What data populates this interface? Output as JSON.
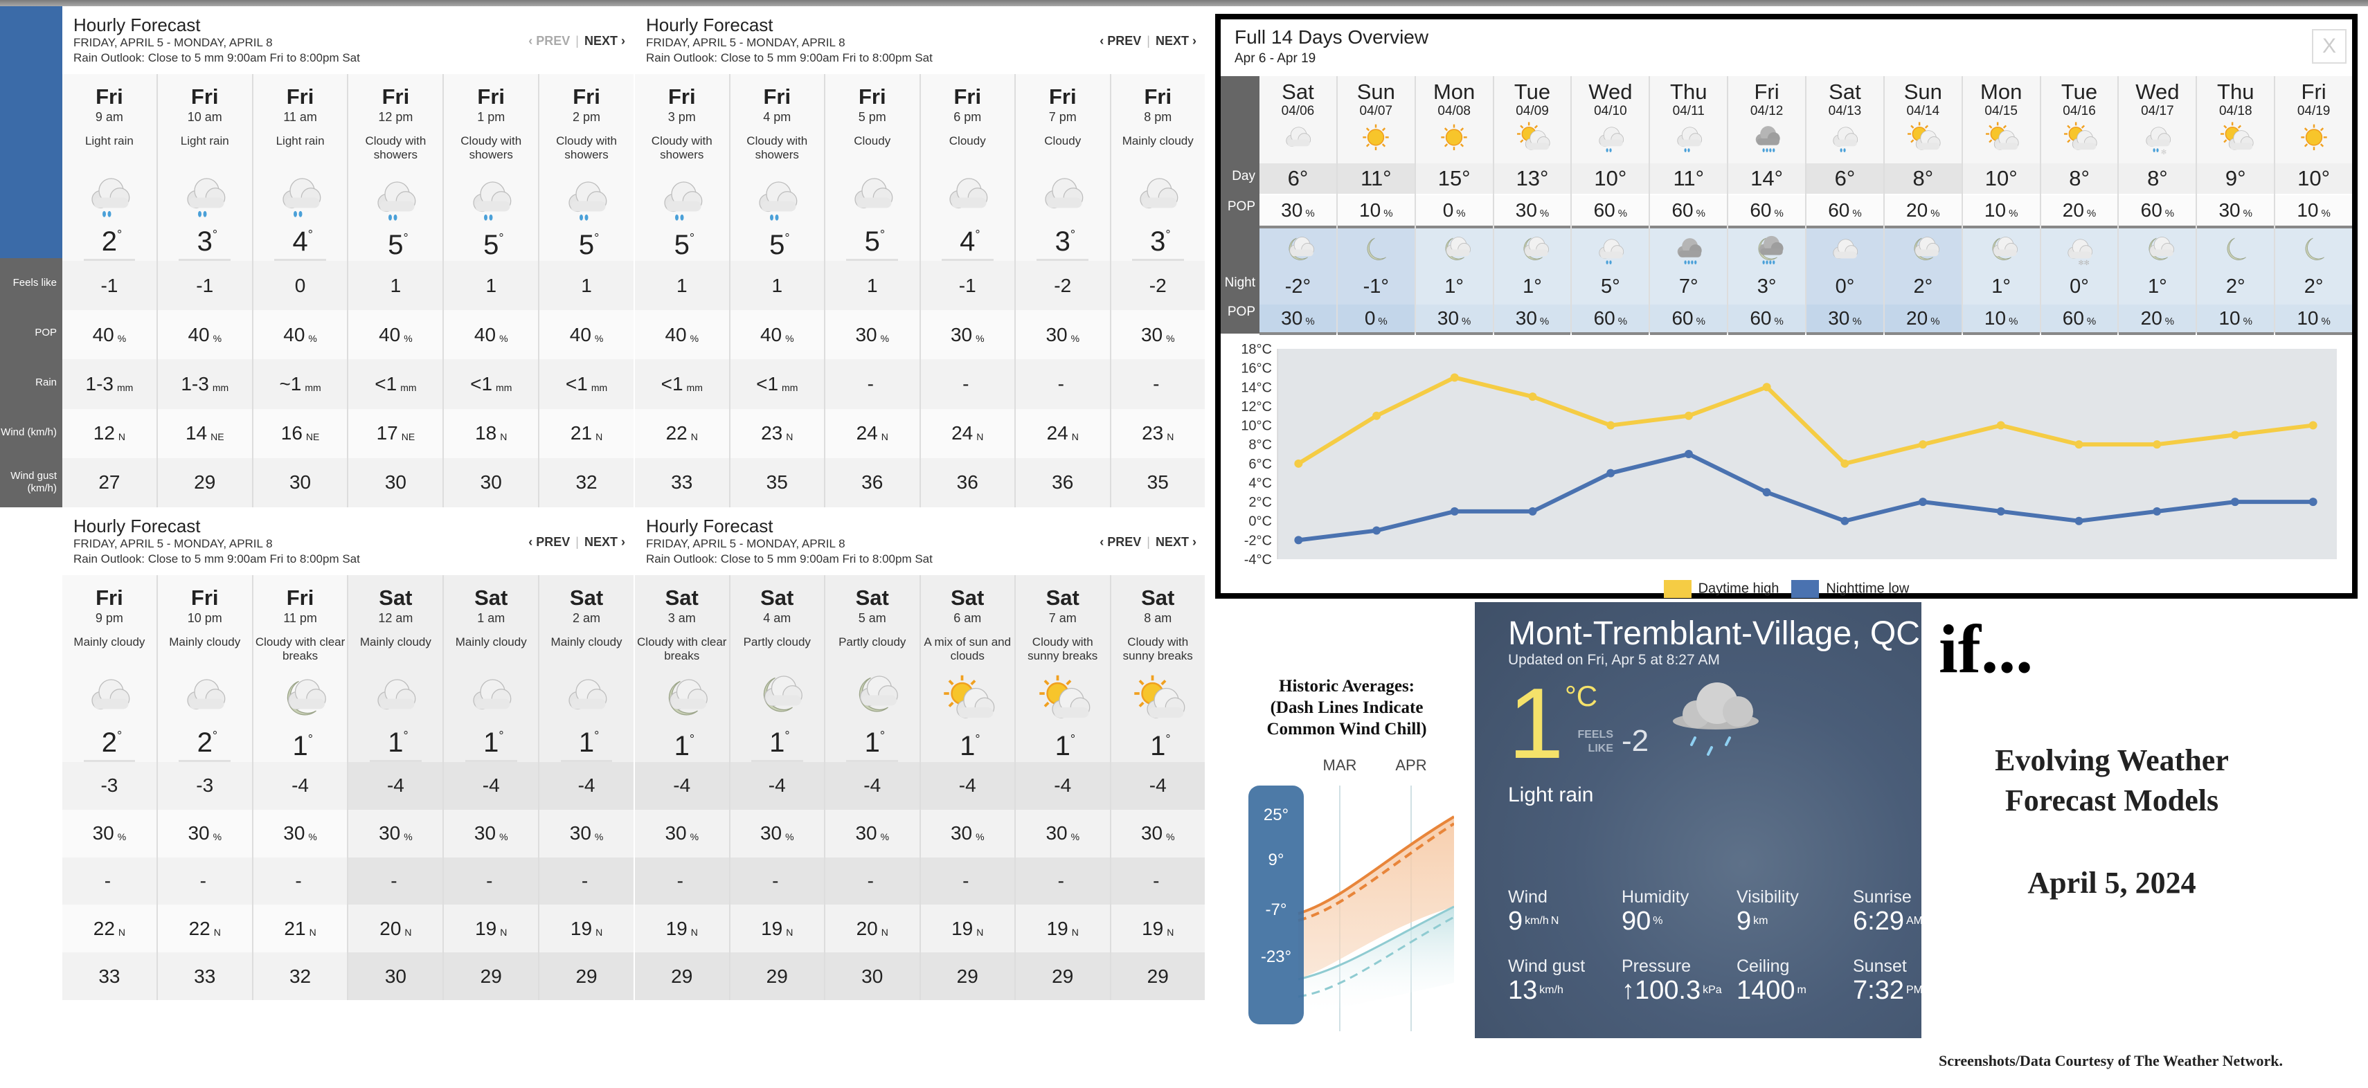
{
  "colors": {
    "accent_blue": "#3b6ba8",
    "label_gray": "#666666",
    "day_high": "#f5cc44",
    "night_low": "#4a72b0",
    "current_temp": "#f5e26a"
  },
  "row_labels": [
    "Feels like",
    "POP",
    "Rain",
    "Wind (km/h)",
    "Wind gust (km/h)"
  ],
  "hourly_panels": [
    {
      "title": "Hourly Forecast",
      "range": "FRIDAY, APRIL 5 - MONDAY, APRIL 8",
      "outlook": "Rain Outlook: Close to 5 mm 9:00am Fri to 8:00pm Sat",
      "prev": "‹ PREV",
      "next": "NEXT ›",
      "prev_disabled": true,
      "hours": [
        {
          "day": "Fri",
          "hour": "9 am",
          "cond": "Light rain",
          "icon": "rain-cloud-icon",
          "temp": "2",
          "feels": "-1",
          "pop": "40",
          "rain": "1-3",
          "rain_unit": "mm",
          "wind": "12",
          "dir": "N",
          "gust": "27"
        },
        {
          "day": "Fri",
          "hour": "10 am",
          "cond": "Light rain",
          "icon": "rain-cloud-icon",
          "temp": "3",
          "feels": "-1",
          "pop": "40",
          "rain": "1-3",
          "rain_unit": "mm",
          "wind": "14",
          "dir": "NE",
          "gust": "29"
        },
        {
          "day": "Fri",
          "hour": "11 am",
          "cond": "Light rain",
          "icon": "rain-cloud-icon",
          "temp": "4",
          "feels": "0",
          "pop": "40",
          "rain": "~1",
          "rain_unit": "mm",
          "wind": "16",
          "dir": "NE",
          "gust": "30"
        },
        {
          "day": "Fri",
          "hour": "12 pm",
          "cond": "Cloudy with showers",
          "icon": "rain-cloud-icon",
          "temp": "5",
          "feels": "1",
          "pop": "40",
          "rain": "<1",
          "rain_unit": "mm",
          "wind": "17",
          "dir": "NE",
          "gust": "30"
        },
        {
          "day": "Fri",
          "hour": "1 pm",
          "cond": "Cloudy with showers",
          "icon": "rain-cloud-icon",
          "temp": "5",
          "feels": "1",
          "pop": "40",
          "rain": "<1",
          "rain_unit": "mm",
          "wind": "18",
          "dir": "N",
          "gust": "30"
        },
        {
          "day": "Fri",
          "hour": "2 pm",
          "cond": "Cloudy with showers",
          "icon": "rain-cloud-icon",
          "temp": "5",
          "feels": "1",
          "pop": "40",
          "rain": "<1",
          "rain_unit": "mm",
          "wind": "21",
          "dir": "N",
          "gust": "32"
        }
      ]
    },
    {
      "title": "Hourly Forecast",
      "range": "FRIDAY, APRIL 5 - MONDAY, APRIL 8",
      "outlook": "Rain Outlook: Close to 5 mm 9:00am Fri to 8:00pm Sat",
      "prev": "‹ PREV",
      "next": "NEXT ›",
      "prev_disabled": false,
      "hours": [
        {
          "day": "Fri",
          "hour": "3 pm",
          "cond": "Cloudy with showers",
          "icon": "rain-cloud-icon",
          "temp": "5",
          "feels": "1",
          "pop": "40",
          "rain": "<1",
          "rain_unit": "mm",
          "wind": "22",
          "dir": "N",
          "gust": "33"
        },
        {
          "day": "Fri",
          "hour": "4 pm",
          "cond": "Cloudy with showers",
          "icon": "rain-cloud-icon",
          "temp": "5",
          "feels": "1",
          "pop": "40",
          "rain": "<1",
          "rain_unit": "mm",
          "wind": "23",
          "dir": "N",
          "gust": "35"
        },
        {
          "day": "Fri",
          "hour": "5 pm",
          "cond": "Cloudy",
          "icon": "cloud-icon",
          "temp": "5",
          "feels": "1",
          "pop": "30",
          "rain": "-",
          "rain_unit": "",
          "wind": "24",
          "dir": "N",
          "gust": "36"
        },
        {
          "day": "Fri",
          "hour": "6 pm",
          "cond": "Cloudy",
          "icon": "cloud-icon",
          "temp": "4",
          "feels": "-1",
          "pop": "30",
          "rain": "-",
          "rain_unit": "",
          "wind": "24",
          "dir": "N",
          "gust": "36"
        },
        {
          "day": "Fri",
          "hour": "7 pm",
          "cond": "Cloudy",
          "icon": "cloud-icon",
          "temp": "3",
          "feels": "-2",
          "pop": "30",
          "rain": "-",
          "rain_unit": "",
          "wind": "24",
          "dir": "N",
          "gust": "36"
        },
        {
          "day": "Fri",
          "hour": "8 pm",
          "cond": "Mainly cloudy",
          "icon": "cloud-icon",
          "temp": "3",
          "feels": "-2",
          "pop": "30",
          "rain": "-",
          "rain_unit": "",
          "wind": "23",
          "dir": "N",
          "gust": "35"
        }
      ]
    },
    {
      "title": "Hourly Forecast",
      "range": "FRIDAY, APRIL 5 - MONDAY, APRIL 8",
      "outlook": "Rain Outlook: Close to 5 mm 9:00am Fri to 8:00pm Sat",
      "prev": "‹ PREV",
      "next": "NEXT ›",
      "prev_disabled": false,
      "hours": [
        {
          "day": "Fri",
          "hour": "9 pm",
          "cond": "Mainly cloudy",
          "icon": "cloud-icon",
          "temp": "2",
          "feels": "-3",
          "pop": "30",
          "rain": "-",
          "rain_unit": "",
          "wind": "22",
          "dir": "N",
          "gust": "33"
        },
        {
          "day": "Fri",
          "hour": "10 pm",
          "cond": "Mainly cloudy",
          "icon": "cloud-icon",
          "temp": "2",
          "feels": "-3",
          "pop": "30",
          "rain": "-",
          "rain_unit": "",
          "wind": "22",
          "dir": "N",
          "gust": "33"
        },
        {
          "day": "Fri",
          "hour": "11 pm",
          "cond": "Cloudy with clear breaks",
          "icon": "moon-cloud-icon",
          "temp": "1",
          "feels": "-4",
          "pop": "30",
          "rain": "-",
          "rain_unit": "",
          "wind": "21",
          "dir": "N",
          "gust": "32"
        },
        {
          "day": "Sat",
          "hour": "12 am",
          "cond": "Mainly cloudy",
          "icon": "cloud-icon",
          "temp": "1",
          "feels": "-4",
          "pop": "30",
          "rain": "-",
          "rain_unit": "",
          "wind": "20",
          "dir": "N",
          "gust": "30"
        },
        {
          "day": "Sat",
          "hour": "1 am",
          "cond": "Mainly cloudy",
          "icon": "cloud-icon",
          "temp": "1",
          "feels": "-4",
          "pop": "30",
          "rain": "-",
          "rain_unit": "",
          "wind": "19",
          "dir": "N",
          "gust": "29"
        },
        {
          "day": "Sat",
          "hour": "2 am",
          "cond": "Mainly cloudy",
          "icon": "cloud-icon",
          "temp": "1",
          "feels": "-4",
          "pop": "30",
          "rain": "-",
          "rain_unit": "",
          "wind": "19",
          "dir": "N",
          "gust": "29"
        }
      ]
    },
    {
      "title": "Hourly Forecast",
      "range": "FRIDAY, APRIL 5 - MONDAY, APRIL 8",
      "outlook": "Rain Outlook: Close to 5 mm 9:00am Fri to 8:00pm Sat",
      "prev": "‹ PREV",
      "next": "NEXT ›",
      "prev_disabled": false,
      "hours": [
        {
          "day": "Sat",
          "hour": "3 am",
          "cond": "Cloudy with clear breaks",
          "icon": "moon-cloud-icon",
          "temp": "1",
          "feels": "-4",
          "pop": "30",
          "rain": "-",
          "rain_unit": "",
          "wind": "19",
          "dir": "N",
          "gust": "29"
        },
        {
          "day": "Sat",
          "hour": "4 am",
          "cond": "Partly cloudy",
          "icon": "moon-cloud-icon",
          "temp": "1",
          "feels": "-4",
          "pop": "30",
          "rain": "-",
          "rain_unit": "",
          "wind": "19",
          "dir": "N",
          "gust": "29"
        },
        {
          "day": "Sat",
          "hour": "5 am",
          "cond": "Partly cloudy",
          "icon": "moon-cloud-icon",
          "temp": "1",
          "feels": "-4",
          "pop": "30",
          "rain": "-",
          "rain_unit": "",
          "wind": "20",
          "dir": "N",
          "gust": "30"
        },
        {
          "day": "Sat",
          "hour": "6 am",
          "cond": "A mix of sun and clouds",
          "icon": "sun-cloud-icon",
          "temp": "1",
          "feels": "-4",
          "pop": "30",
          "rain": "-",
          "rain_unit": "",
          "wind": "19",
          "dir": "N",
          "gust": "29"
        },
        {
          "day": "Sat",
          "hour": "7 am",
          "cond": "Cloudy with sunny breaks",
          "icon": "sun-cloud-icon",
          "temp": "1",
          "feels": "-4",
          "pop": "30",
          "rain": "-",
          "rain_unit": "",
          "wind": "19",
          "dir": "N",
          "gust": "29"
        },
        {
          "day": "Sat",
          "hour": "8 am",
          "cond": "Cloudy with sunny breaks",
          "icon": "sun-cloud-icon",
          "temp": "1",
          "feels": "-4",
          "pop": "30",
          "rain": "-",
          "rain_unit": "",
          "wind": "19",
          "dir": "N",
          "gust": "29"
        }
      ]
    }
  ],
  "fourteen_day": {
    "title": "Full 14 Days Overview",
    "range": "Apr 6 - Apr 19",
    "close_label": "X",
    "row_labels": {
      "day": "Day",
      "pop": "POP",
      "night": "Night",
      "npop": "POP"
    },
    "days": [
      {
        "name": "Sat",
        "date": "04/06",
        "day_icon": "cloud-icon",
        "hi": "6°",
        "pop": "30",
        "night_icon": "moon-cloud-icon",
        "lo": "-2°",
        "npop": "30"
      },
      {
        "name": "Sun",
        "date": "04/07",
        "day_icon": "sun-icon",
        "hi": "11°",
        "pop": "10",
        "night_icon": "moon-icon",
        "lo": "-1°",
        "npop": "0"
      },
      {
        "name": "Mon",
        "date": "04/08",
        "day_icon": "sun-icon",
        "hi": "15°",
        "pop": "0",
        "night_icon": "moon-cloud-icon",
        "lo": "1°",
        "npop": "30"
      },
      {
        "name": "Tue",
        "date": "04/09",
        "day_icon": "sun-cloud-icon",
        "hi": "13°",
        "pop": "30",
        "night_icon": "moon-cloud-icon",
        "lo": "1°",
        "npop": "30"
      },
      {
        "name": "Wed",
        "date": "04/10",
        "day_icon": "rain-cloud-icon",
        "hi": "10°",
        "pop": "60",
        "night_icon": "rain-cloud-icon",
        "lo": "5°",
        "npop": "60"
      },
      {
        "name": "Thu",
        "date": "04/11",
        "day_icon": "rain-cloud-icon",
        "hi": "11°",
        "pop": "60",
        "night_icon": "heavy-rain-icon",
        "lo": "7°",
        "npop": "60"
      },
      {
        "name": "Fri",
        "date": "04/12",
        "day_icon": "heavy-rain-icon",
        "hi": "14°",
        "pop": "60",
        "night_icon": "moon-rain-icon",
        "lo": "3°",
        "npop": "60"
      },
      {
        "name": "Sat",
        "date": "04/13",
        "day_icon": "rain-cloud-icon",
        "hi": "6°",
        "pop": "60",
        "night_icon": "cloud-icon",
        "lo": "0°",
        "npop": "30"
      },
      {
        "name": "Sun",
        "date": "04/14",
        "day_icon": "sun-cloud-icon",
        "hi": "8°",
        "pop": "20",
        "night_icon": "moon-cloud-icon",
        "lo": "2°",
        "npop": "20"
      },
      {
        "name": "Mon",
        "date": "04/15",
        "day_icon": "sun-cloud-icon",
        "hi": "10°",
        "pop": "10",
        "night_icon": "moon-cloud-icon",
        "lo": "1°",
        "npop": "10"
      },
      {
        "name": "Tue",
        "date": "04/16",
        "day_icon": "sun-cloud-icon",
        "hi": "8°",
        "pop": "20",
        "night_icon": "flurries-icon",
        "lo": "0°",
        "npop": "60"
      },
      {
        "name": "Wed",
        "date": "04/17",
        "day_icon": "rain-snow-icon",
        "hi": "8°",
        "pop": "60",
        "night_icon": "moon-cloud-icon",
        "lo": "1°",
        "npop": "20"
      },
      {
        "name": "Thu",
        "date": "04/18",
        "day_icon": "sun-cloud-icon",
        "hi": "9°",
        "pop": "30",
        "night_icon": "moon-icon",
        "lo": "2°",
        "npop": "10"
      },
      {
        "name": "Fri",
        "date": "04/19",
        "day_icon": "sun-icon",
        "hi": "10°",
        "pop": "10",
        "night_icon": "moon-icon",
        "lo": "2°",
        "npop": "10"
      }
    ]
  },
  "chart_data": {
    "type": "line",
    "title": "",
    "x": [
      "04/06",
      "04/07",
      "04/08",
      "04/09",
      "04/10",
      "04/11",
      "04/12",
      "04/13",
      "04/14",
      "04/15",
      "04/16",
      "04/17",
      "04/18",
      "04/19"
    ],
    "series": [
      {
        "name": "Daytime high",
        "color": "#f5cc44",
        "values": [
          6,
          11,
          15,
          13,
          10,
          11,
          14,
          6,
          8,
          10,
          8,
          8,
          9,
          10
        ]
      },
      {
        "name": "Nighttime low",
        "color": "#4a72b0",
        "values": [
          -2,
          -1,
          1,
          1,
          5,
          7,
          3,
          0,
          2,
          1,
          0,
          1,
          2,
          2
        ]
      }
    ],
    "ytick_labels": [
      "18°C",
      "16°C",
      "14°C",
      "12°C",
      "10°C",
      "8°C",
      "6°C",
      "4°C",
      "2°C",
      "0°C",
      "-2°C",
      "-4°C"
    ],
    "yticks": [
      18,
      16,
      14,
      12,
      10,
      8,
      6,
      4,
      2,
      0,
      -2,
      -4
    ],
    "ylim": [
      -4,
      18
    ],
    "xlabel": "",
    "ylabel": "",
    "legend": "bottom-center",
    "grid": false
  },
  "historic": {
    "title_lines": [
      "Historic Averages:",
      "(Dash Lines Indicate",
      "Common Wind Chill)"
    ],
    "months": [
      "MAR",
      "APR"
    ],
    "scale": [
      "25°",
      "9°",
      "-7°",
      "-23°"
    ]
  },
  "current": {
    "location": "Mont-Tremblant-Village, QC",
    "updated": "Updated on Fri, Apr 5 at 8:27 AM",
    "temp": "1",
    "unit": "°C",
    "feels_label_1": "FEELS",
    "feels_label_2": "LIKE",
    "feels": "-2",
    "condition": "Light rain",
    "stats": [
      {
        "label": "Wind",
        "value": "9",
        "unit": "km/h",
        "extra": "N"
      },
      {
        "label": "Humidity",
        "value": "90",
        "unit": "%"
      },
      {
        "label": "Visibility",
        "value": "9",
        "unit": "km"
      },
      {
        "label": "Sunrise",
        "value": "6:29",
        "unit": "AM"
      },
      {
        "label": "Wind gust",
        "value": "13",
        "unit": "km/h"
      },
      {
        "label": "Pressure",
        "value": "↑100.3",
        "unit": "kPa"
      },
      {
        "label": "Ceiling",
        "value": "1400",
        "unit": "m"
      },
      {
        "label": "Sunset",
        "value": "7:32",
        "unit": "PM"
      }
    ]
  },
  "annotation": {
    "if": "if...",
    "title_line1": "Evolving Weather",
    "title_line2": "Forecast Models",
    "date": "April 5, 2024",
    "credit": "Screenshots/Data Courtesy of The Weather Network."
  }
}
